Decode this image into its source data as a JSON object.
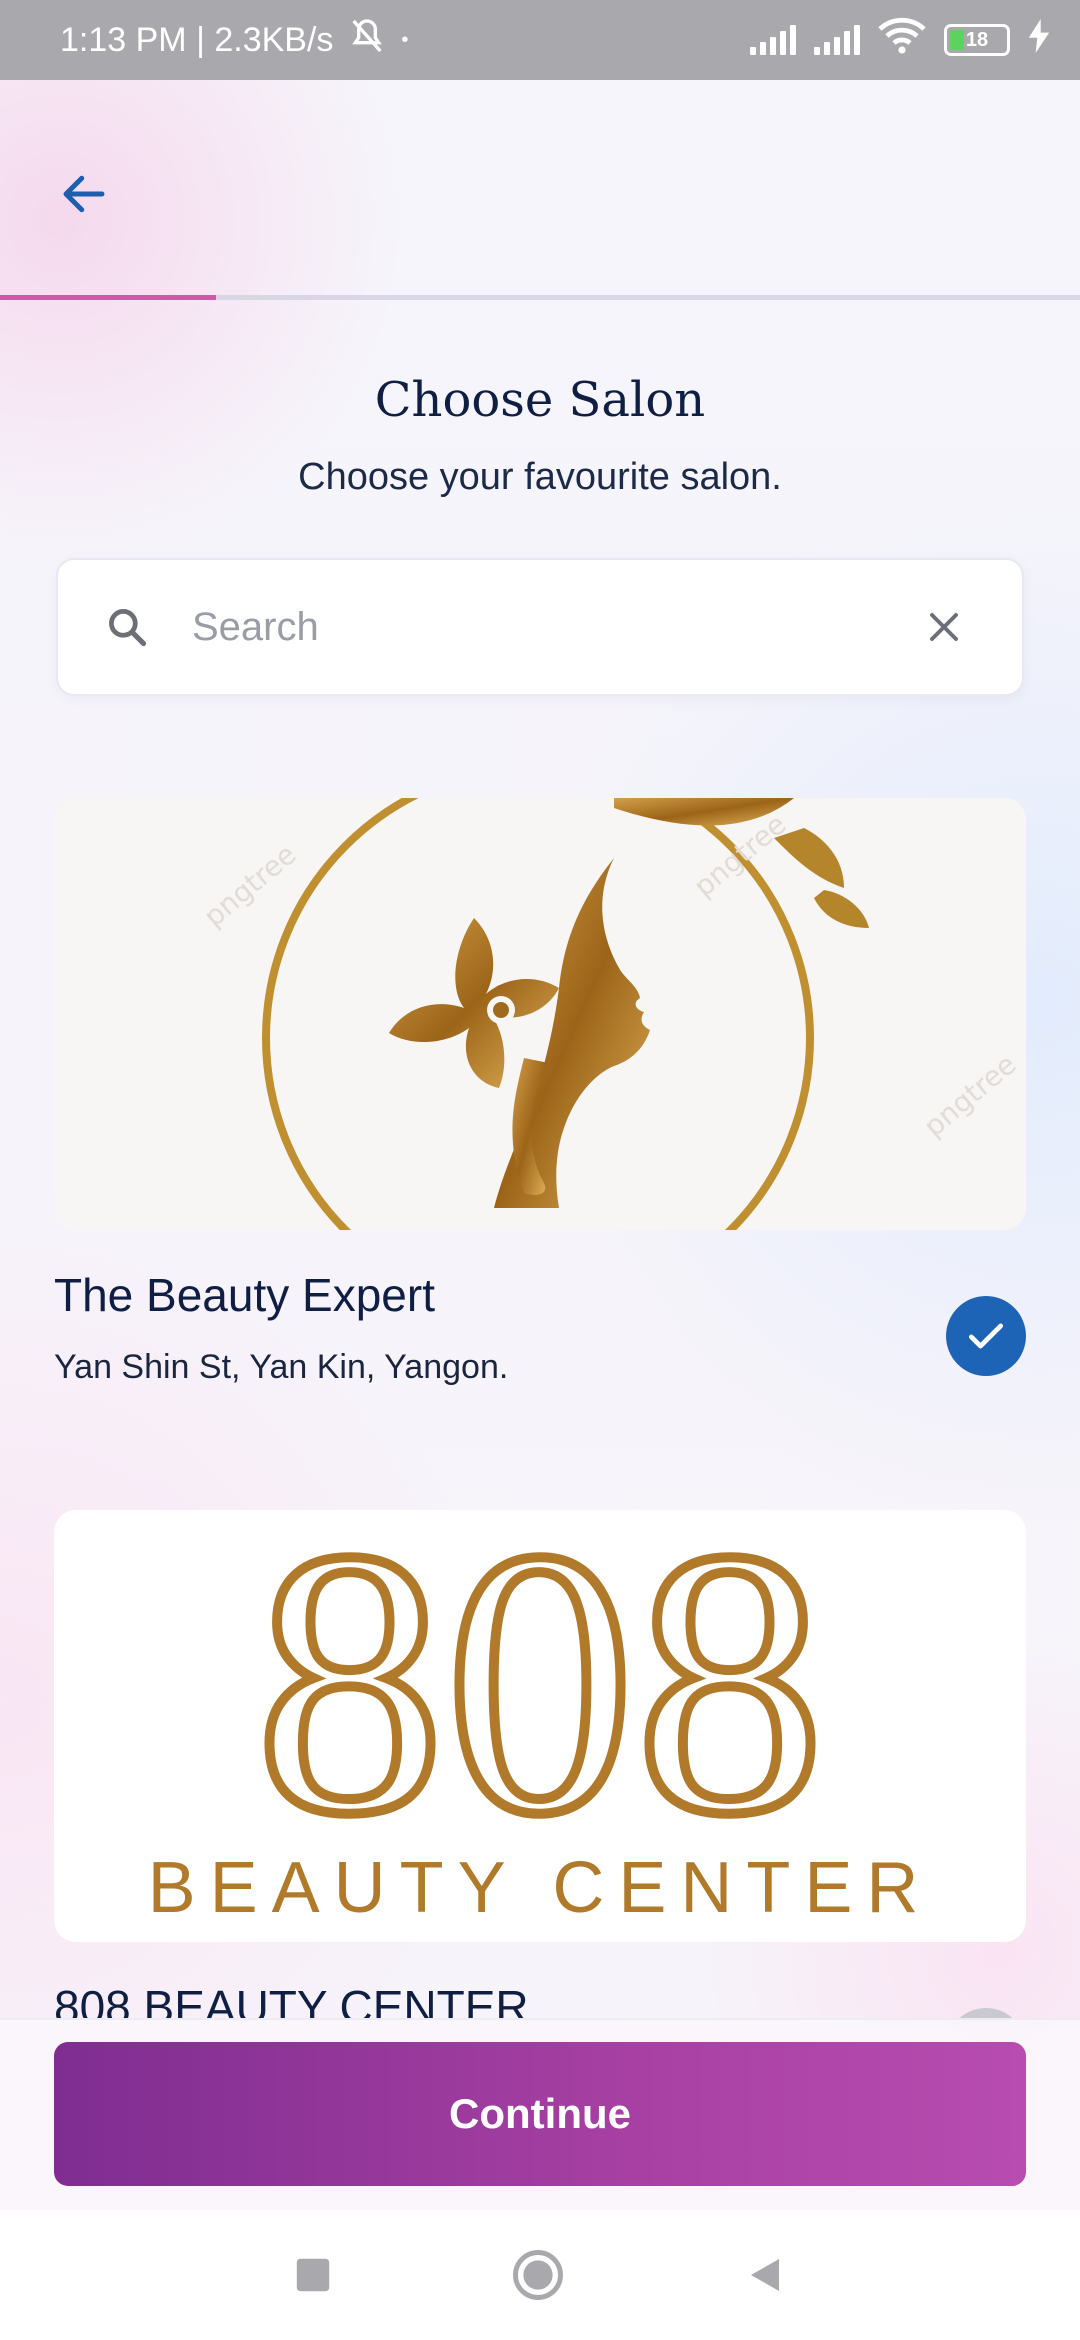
{
  "status_bar": {
    "time_speed": "1:13 PM | 2.3KB/s",
    "battery_level": "18"
  },
  "header": {
    "back_icon": "arrow-left-icon",
    "progress_percent": 20
  },
  "title": "Choose Salon",
  "subtitle": "Choose your favourite salon.",
  "search": {
    "placeholder": "Search",
    "value": ""
  },
  "salons": [
    {
      "name": "The Beauty Expert",
      "address": "Yan Shin St, Yan Kin, Yangon.",
      "selected": true,
      "watermark": "pngtree"
    },
    {
      "name": "808 BEAUTY CENTER",
      "logo_number": "808",
      "logo_text": "BEAUTY CENTER",
      "selected": false
    }
  ],
  "continue_label": "Continue",
  "colors": {
    "accent_blue": "#1d63b6",
    "progress_pink": "#d158a8",
    "button_gradient_start": "#7f2d91",
    "button_gradient_end": "#b84cb0",
    "gold": "#b07a2a"
  }
}
